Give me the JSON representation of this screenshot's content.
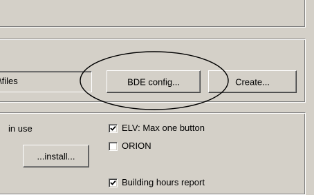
{
  "connection": {
    "path_value": "\\files",
    "bde_config_label": "BDE config...",
    "create_label": "Create..."
  },
  "options": {
    "in_use_label": "in use",
    "install_label": "...install...",
    "checkboxes": [
      {
        "label": "ELV: Max one button",
        "checked": true
      },
      {
        "label": "ORION",
        "checked": false
      },
      {
        "label": "Building hours report",
        "checked": true
      }
    ]
  },
  "annotation": {
    "ellipse_color": "#000000"
  },
  "icons": [
    "check-mark-icon"
  ]
}
